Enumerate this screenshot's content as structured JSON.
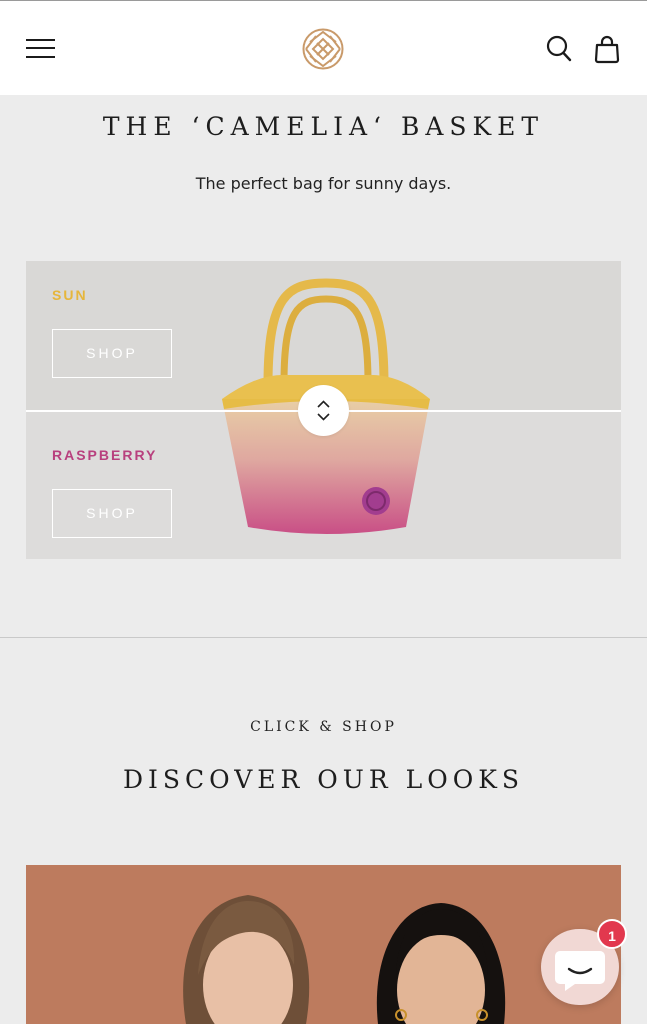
{
  "header": {
    "menu_icon": "hamburger-menu-icon",
    "logo_icon": "brand-lattice-logo",
    "search_icon": "search-icon",
    "cart_icon": "shopping-bag-icon"
  },
  "basket": {
    "title": "THE ‘CAMELIA‘ BASKET",
    "subtitle": "The perfect bag for sunny days.",
    "variants": [
      {
        "name": "SUN",
        "button": "SHOP",
        "color": "#e6b63b"
      },
      {
        "name": "RASPBERRY",
        "button": "SHOP",
        "color": "#b8407e"
      }
    ],
    "slider_icon": "chevron-up-down-icon"
  },
  "looks": {
    "eyebrow": "CLICK & SHOP",
    "title": "DISCOVER OUR LOOKS"
  },
  "chat": {
    "icon": "chat-bubble-icon",
    "badge": "1"
  }
}
